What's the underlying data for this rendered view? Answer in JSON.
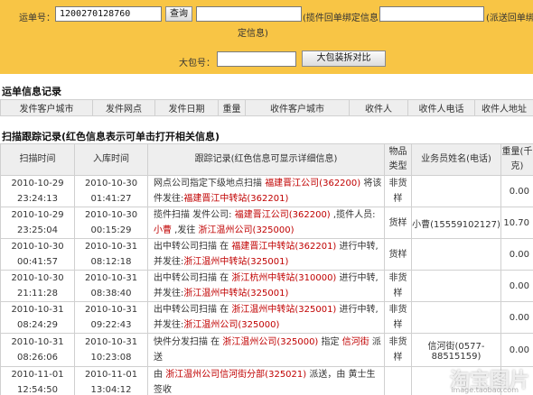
{
  "search": {
    "waybill_label": "运单号：",
    "waybill_value": "1200270128760",
    "query_btn": "查询",
    "bind_note1": "(揽件回单绑定信息)",
    "bind_note2": "(派送回单绑",
    "bind_note3": "定信息)",
    "package_label": "大包号：",
    "package_btn": "大包装拆对比"
  },
  "waybill_info": {
    "title": "运单信息记录",
    "headers": [
      "发件客户城市",
      "发件网点",
      "发件日期",
      "重量",
      "收件客户城市",
      "收件人",
      "收件人电话",
      "收件人地址"
    ]
  },
  "scan": {
    "title": "扫描跟踪记录(红色信息表示可单击打开相关信息)",
    "headers": {
      "scan_time": "扫描时间",
      "in_time": "入库时间",
      "record": "跟踪记录(红色信息可显示详细信息)",
      "type": "物品类型",
      "staff": "业务员姓名(电话)",
      "weight": "重量(千克)"
    },
    "rows": [
      {
        "scan_date": "2010-10-29",
        "scan_clock": "23:24:13",
        "in_date": "2010-10-30",
        "in_clock": "01:41:27",
        "record": [
          {
            "t": "网点公司指定下级地点扫描 "
          },
          {
            "t": "福建晋江公司(362200)",
            "red": true
          },
          {
            "t": " 将该件发往:"
          },
          {
            "t": "福建晋江中转站(362201)",
            "red": true
          }
        ],
        "type": "非货样",
        "staff": "",
        "weight": "0.00"
      },
      {
        "scan_date": "2010-10-29",
        "scan_clock": "23:25:04",
        "in_date": "2010-10-30",
        "in_clock": "00:15:29",
        "record": [
          {
            "t": "揽件扫描 发件公司: "
          },
          {
            "t": "福建晋江公司(362200)",
            "red": true
          },
          {
            "t": " ,揽件人员: "
          },
          {
            "t": "小曹",
            "red": true
          },
          {
            "t": " ,发往 "
          },
          {
            "t": "浙江温州公司(325000)",
            "red": true
          }
        ],
        "type": "货样",
        "staff": "小曹(15559102127)",
        "weight": "10.70"
      },
      {
        "scan_date": "2010-10-30",
        "scan_clock": "00:41:57",
        "in_date": "2010-10-31",
        "in_clock": "08:12:18",
        "record": [
          {
            "t": "出中转公司扫描 在 "
          },
          {
            "t": "福建晋江中转站(362201)",
            "red": true
          },
          {
            "t": " 进行中转,并发往:"
          },
          {
            "t": "浙江温州中转站(325001)",
            "red": true
          }
        ],
        "type": "货样",
        "staff": "",
        "weight": "0.00"
      },
      {
        "scan_date": "2010-10-30",
        "scan_clock": "21:11:28",
        "in_date": "2010-10-31",
        "in_clock": "08:38:40",
        "record": [
          {
            "t": "出中转公司扫描 在 "
          },
          {
            "t": "浙江杭州中转站(310000)",
            "red": true
          },
          {
            "t": " 进行中转,并发往:"
          },
          {
            "t": "浙江温州中转站(325001)",
            "red": true
          }
        ],
        "type": "非货样",
        "staff": "",
        "weight": "0.00"
      },
      {
        "scan_date": "2010-10-31",
        "scan_clock": "08:24:29",
        "in_date": "2010-10-31",
        "in_clock": "09:22:43",
        "record": [
          {
            "t": "出中转公司扫描 在 "
          },
          {
            "t": "浙江温州中转站(325001)",
            "red": true
          },
          {
            "t": " 进行中转,并发往:"
          },
          {
            "t": "浙江温州公司(325000)",
            "red": true
          }
        ],
        "type": "非货样",
        "staff": "",
        "weight": "0.00"
      },
      {
        "scan_date": "2010-10-31",
        "scan_clock": "08:26:06",
        "in_date": "2010-10-31",
        "in_clock": "10:23:08",
        "record": [
          {
            "t": "快件分发扫描 在 "
          },
          {
            "t": "浙江温州公司(325000)",
            "red": true
          },
          {
            "t": " 指定 "
          },
          {
            "t": "信河街",
            "red": true
          },
          {
            "t": " 派送"
          }
        ],
        "type": "非货样",
        "staff": "信河街(0577-88515159)",
        "weight": "0.00"
      },
      {
        "scan_date": "2010-11-01",
        "scan_clock": "12:54:50",
        "in_date": "2010-11-01",
        "in_clock": "13:04:12",
        "record": [
          {
            "t": "由 "
          },
          {
            "t": "浙江温州公司信河街分部(325021)",
            "red": true
          },
          {
            "t": " 派送，由 黄士生 签收"
          }
        ],
        "type": "",
        "staff": "",
        "weight": ""
      }
    ]
  },
  "watermark": {
    "main": "淘宝图片",
    "sub": "image.taobao.com"
  }
}
